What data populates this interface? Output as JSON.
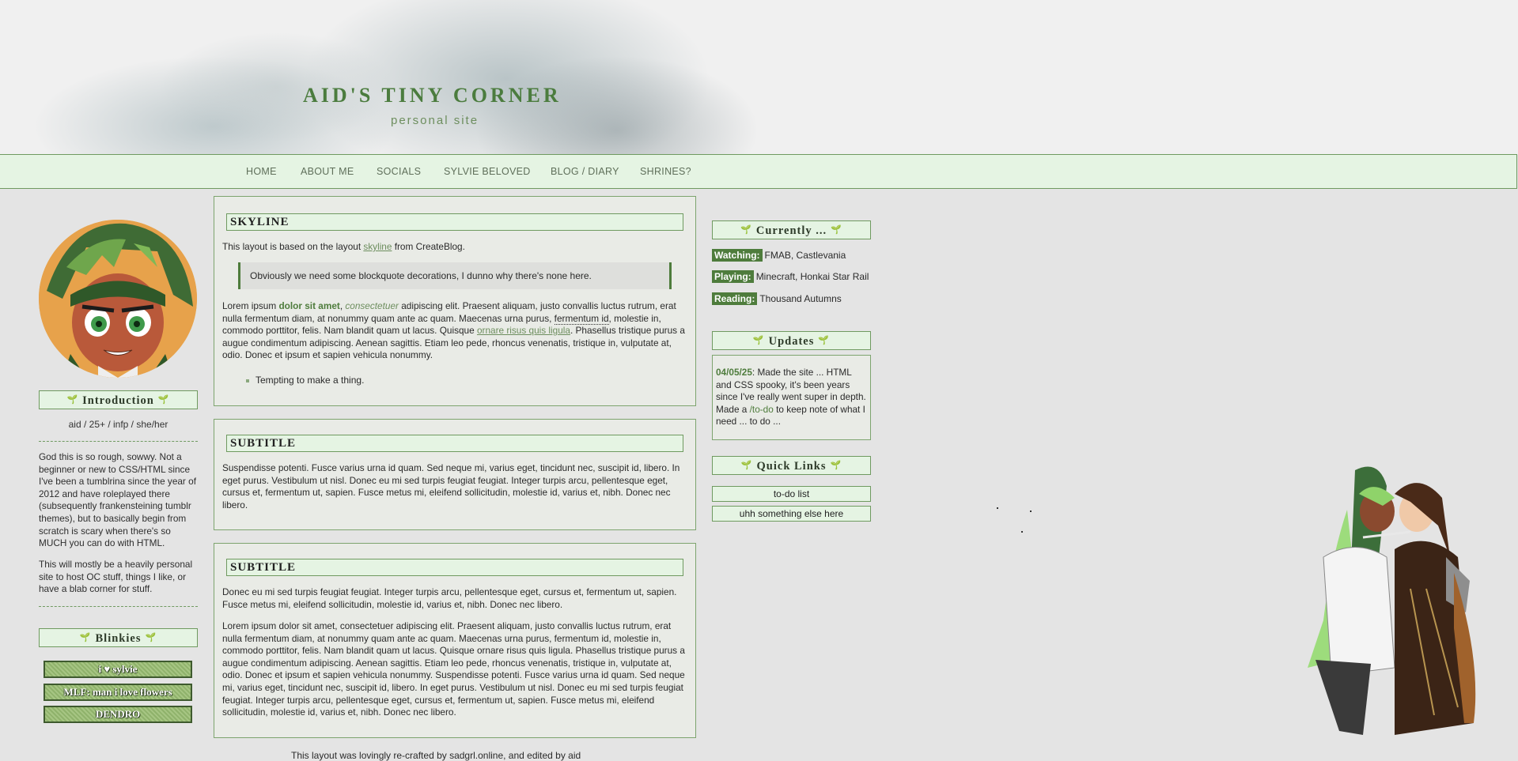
{
  "header": {
    "title": "AID'S TINY CORNER",
    "subtitle": "personal site"
  },
  "nav": [
    "HOME",
    "ABOUT ME",
    "SOCIALS",
    "SYLVIE BELOVED",
    "BLOG / DIARY",
    "SHRINES?"
  ],
  "left": {
    "intro_title": "Introduction",
    "pronouns": "aid / 25+ / infp / she/her",
    "bio_1": "God this is so rough, sowwy. Not a beginner or new to CSS/HTML since I've been a tumblrina since the year of 2012 and have roleplayed there (subsequently frankensteining tumblr themes), but to basically begin from scratch is scary when there's so MUCH you can do with HTML.",
    "bio_2": "This will mostly be a heavily personal site to host OC stuff, things I like, or have a blab corner for stuff.",
    "blinkies_title": "Blinkies",
    "blinkies": [
      "i ♥ sylvie",
      "MLF: man i love flowers",
      "DENDRO"
    ]
  },
  "main": {
    "panel1": {
      "title": "SKYLINE",
      "intro_pre": "This layout is based on the layout ",
      "intro_link": "skyline",
      "intro_post": " from CreateBlog.",
      "blockquote": "Obviously we need some blockquote decorations, I dunno why there's none here.",
      "p_a": "Lorem ipsum ",
      "p_bold": "dolor sit amet",
      "p_comma": ", ",
      "p_italic": "consectetuer",
      "p_b": " adipiscing elit. Praesent aliquam, justo convallis luctus rutrum, erat nulla fermentum diam, at nonummy quam ante ac quam. Maecenas urna purus, ",
      "p_abbr": "fermentum id",
      "p_c": ", molestie in, commodo porttitor, felis. Nam blandit quam ut lacus. Quisque ",
      "p_link": "ornare risus quis ligula",
      "p_d": ". Phasellus tristique purus a augue condimentum adipiscing. Aenean sagittis. Etiam leo pede, rhoncus venenatis, tristique in, vulputate at, odio. Donec et ipsum et sapien vehicula nonummy.",
      "bullet": "Tempting to make a thing."
    },
    "panel2": {
      "title": "SUBTITLE",
      "text": "Suspendisse potenti. Fusce varius urna id quam. Sed neque mi, varius eget, tincidunt nec, suscipit id, libero. In eget purus. Vestibulum ut nisl. Donec eu mi sed turpis feugiat feugiat. Integer turpis arcu, pellentesque eget, cursus et, fermentum ut, sapien. Fusce metus mi, eleifend sollicitudin, molestie id, varius et, nibh. Donec nec libero."
    },
    "panel3": {
      "title": "SUBTITLE",
      "text1": "Donec eu mi sed turpis feugiat feugiat. Integer turpis arcu, pellentesque eget, cursus et, fermentum ut, sapien. Fusce metus mi, eleifend sollicitudin, molestie id, varius et, nibh. Donec nec libero.",
      "text2": "Lorem ipsum dolor sit amet, consectetuer adipiscing elit. Praesent aliquam, justo convallis luctus rutrum, erat nulla fermentum diam, at nonummy quam ante ac quam. Maecenas urna purus, fermentum id, molestie in, commodo porttitor, felis. Nam blandit quam ut lacus. Quisque ornare risus quis ligula. Phasellus tristique purus a augue condimentum adipiscing. Aenean sagittis. Etiam leo pede, rhoncus venenatis, tristique in, vulputate at, odio. Donec et ipsum et sapien vehicula nonummy. Suspendisse potenti. Fusce varius urna id quam. Sed neque mi, varius eget, tincidunt nec, suscipit id, libero. In eget purus. Vestibulum ut nisl. Donec eu mi sed turpis feugiat feugiat. Integer turpis arcu, pellentesque eget, cursus et, fermentum ut, sapien. Fusce metus mi, eleifend sollicitudin, molestie id, varius et, nibh. Donec nec libero."
    }
  },
  "right": {
    "currently_title": "Currently ...",
    "currently": [
      {
        "tag": "Watching:",
        "value": "FMAB, Castlevania"
      },
      {
        "tag": "Playing:",
        "value": "Minecraft, Honkai Star Rail"
      },
      {
        "tag": "Reading:",
        "value": "Thousand Autumns"
      }
    ],
    "updates_title": "Updates",
    "update_date": "04/05/25",
    "update_a": ": Made the site ... HTML and CSS spooky, it's been years since I've really went super in depth. Made a ",
    "update_link": "/to-do",
    "update_b": " to keep note of what I need ... to do ...",
    "quicklinks_title": "Quick Links",
    "quicklinks": [
      "to-do list",
      "uhh something else here"
    ]
  },
  "footer": "This layout was lovingly re-crafted by sadgrl.online, and edited by aid",
  "colors": {
    "accent": "#4e7c3c",
    "nav_bg": "#e5f4e3",
    "border": "#6f9a60",
    "page_bg": "#e4e4e4"
  }
}
